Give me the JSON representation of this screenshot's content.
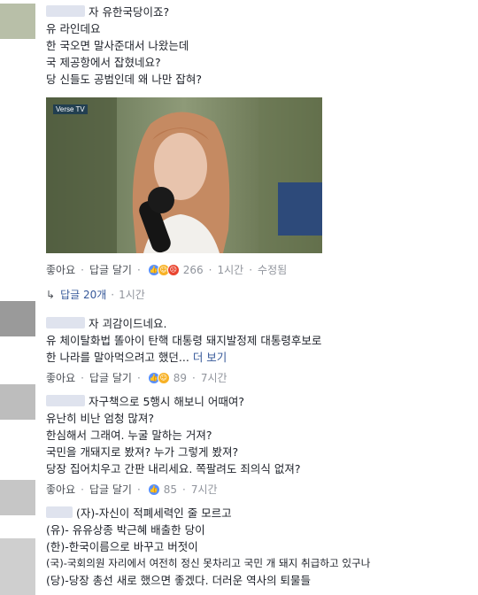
{
  "comments": [
    {
      "lines": [
        "자 유한국당이죠?",
        "유 라인데요",
        "한 국오면 말사준대서 나왔는데",
        "국 제공항에서 잡혔네요?",
        "당 신들도 공범인데 왜 나만 잡혀?"
      ],
      "like_label": "좋아요",
      "reply_label": "답글 달기",
      "reaction_count": "266",
      "time": "1시간",
      "edited": "수정됨",
      "photo_watermark": "Verse TV"
    },
    {
      "lines": [
        "자 괴감이드네요.",
        "유 체이탈화법 똘아이 탄핵 대통령 돼지발정제 대통령후보로",
        "한 나라를 말아먹으려고 했던..."
      ],
      "more_label": "더 보기",
      "like_label": "좋아요",
      "reply_label": "답글 달기",
      "reaction_count": "89",
      "time": "7시간"
    },
    {
      "lines": [
        "자구책으로 5행시 해보니 어때여?",
        "유난히 비난 엄청 많져?",
        "한심해서 그래여. 누굴 말하는 거져?",
        "국민을 개돼지로 봤져? 누가 그렇게 봤져?",
        "당장 집어치우고 간판 내리세요. 쪽팔려도 죄의식 없져?"
      ],
      "like_label": "좋아요",
      "reply_label": "답글 달기",
      "reaction_count": "85",
      "time": "7시간"
    },
    {
      "lines": [
        "(자)-자신이 적폐세력인 줄 모르고",
        "(유)- 유유상종 박근혜 배출한 당이",
        "(한)-한국이름으로 바꾸고 버젓이",
        "(국)-국회의원 자리에서 여전히 정신 못차리고 국민 개 돼지 취급하고 있구나",
        "(당)-당장 총선 새로 했으면 좋겠다. 더러운 역사의 퇴물들"
      ]
    }
  ],
  "replies": {
    "label": "답글 20개",
    "time": "1시간"
  }
}
